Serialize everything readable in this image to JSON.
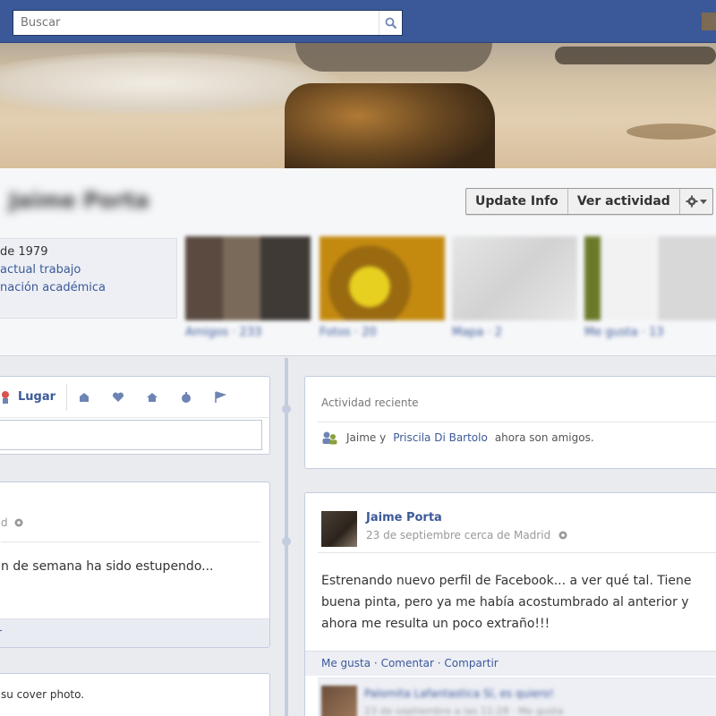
{
  "topbar": {
    "search_placeholder": "Buscar",
    "brand_color": "#3b5998"
  },
  "profile": {
    "name": "Jaime Porta",
    "buttons": {
      "update_info": "Update Info",
      "activity": "Ver actividad"
    },
    "info_lines": [
      "de 1979",
      "actual trabajo",
      "nación académica"
    ],
    "thumbnails": [
      {
        "label": "Amigos · 233"
      },
      {
        "label": "Fotos · 20"
      },
      {
        "label": "Mapa · 2"
      },
      {
        "label": "Me gusta · 13"
      }
    ]
  },
  "composer": {
    "lugar_label": "Lugar",
    "icons": [
      "person-location-icon",
      "life-event-icon",
      "heart-icon",
      "home-icon",
      "thumbs-icon",
      "flag-icon"
    ]
  },
  "left_post": {
    "meta": "d",
    "body": "n de semana ha sido estupendo...",
    "footer_link": "r"
  },
  "left_post_2": {
    "body": "su cover photo."
  },
  "recent_activity": {
    "heading": "Actividad reciente",
    "friend_pre": "Jaime y",
    "friend_name": "Priscila Di Bartolo",
    "friend_post": "ahora son amigos."
  },
  "right_post": {
    "author": "Jaime Porta",
    "date": "23 de septiembre cerca de Madrid",
    "text": "Estrenando nuevo perfil de Facebook... a ver qué tal. Tiene buena pinta, pero ya me había acostumbrado al anterior y ahora me resulta un poco extraño!!!",
    "actions": [
      "Me gusta",
      "Comentar",
      "Compartir"
    ],
    "comment": {
      "name": "Palomita Lafantastica Sí, es quiero!",
      "date": "23 de septiembre a las 11:28 · Me gusta"
    }
  }
}
